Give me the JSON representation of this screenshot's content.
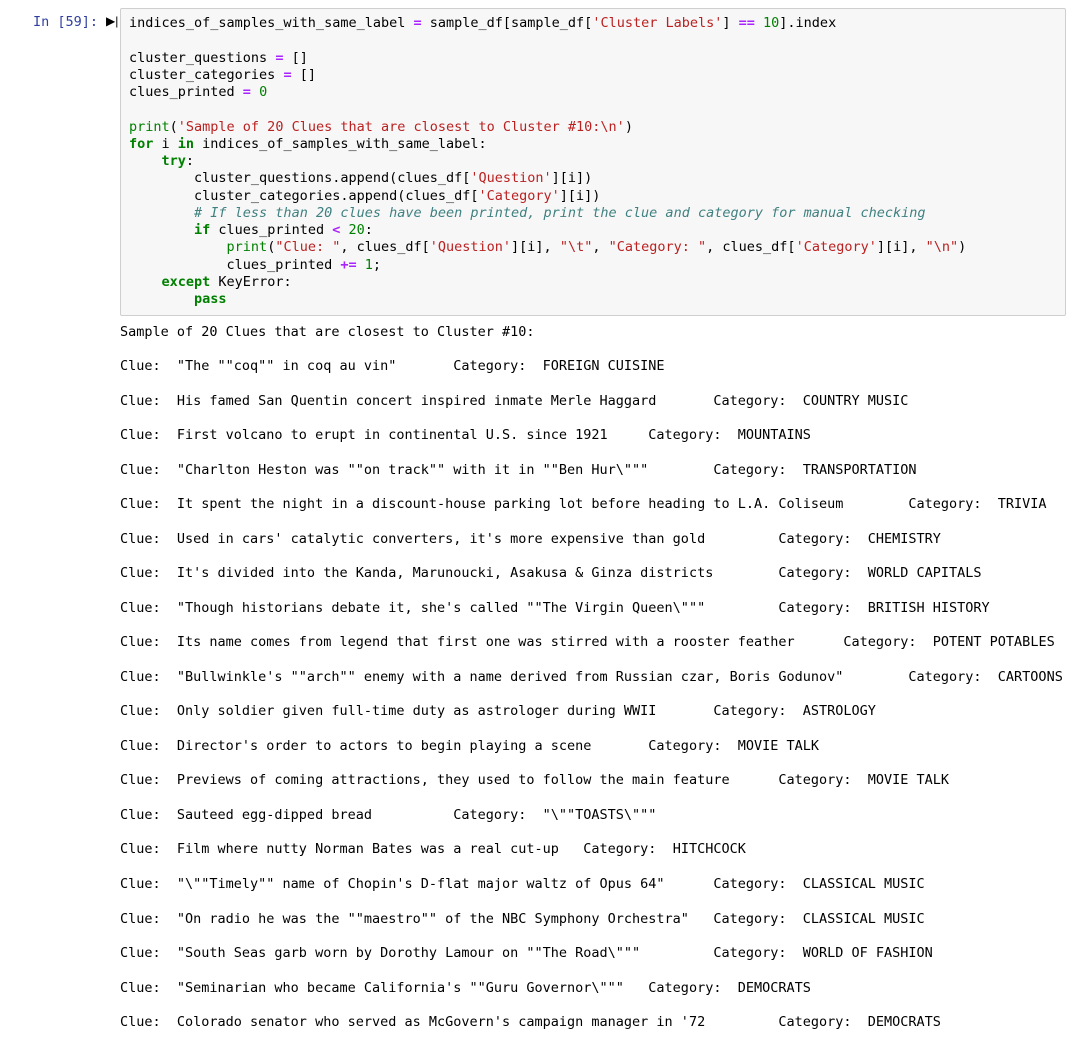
{
  "cell": {
    "prompt": "In [59]:",
    "code_lines": [
      [
        [
          "",
          "indices_of_samples_with_same_label "
        ],
        [
          "op",
          "="
        ],
        [
          "",
          " sample_df[sample_df["
        ],
        [
          "str",
          "'Cluster Labels'"
        ],
        [
          "",
          "] "
        ],
        [
          "op",
          "=="
        ],
        [
          "",
          " "
        ],
        [
          "num",
          "10"
        ],
        [
          "",
          "].index"
        ]
      ],
      [
        [
          "",
          ""
        ]
      ],
      [
        [
          "",
          "cluster_questions "
        ],
        [
          "op",
          "="
        ],
        [
          "",
          " []"
        ]
      ],
      [
        [
          "",
          "cluster_categories "
        ],
        [
          "op",
          "="
        ],
        [
          "",
          " []"
        ]
      ],
      [
        [
          "",
          "clues_printed "
        ],
        [
          "op",
          "="
        ],
        [
          "",
          " "
        ],
        [
          "num",
          "0"
        ]
      ],
      [
        [
          "",
          ""
        ]
      ],
      [
        [
          "bi",
          "print"
        ],
        [
          "",
          "("
        ],
        [
          "str",
          "'Sample of 20 Clues that are closest to Cluster #10:\\n'"
        ],
        [
          "",
          ")"
        ]
      ],
      [
        [
          "kw",
          "for"
        ],
        [
          "",
          " i "
        ],
        [
          "kw",
          "in"
        ],
        [
          "",
          " indices_of_samples_with_same_label:"
        ]
      ],
      [
        [
          "",
          "    "
        ],
        [
          "kw",
          "try"
        ],
        [
          "",
          ":"
        ]
      ],
      [
        [
          "",
          "        cluster_questions.append(clues_df["
        ],
        [
          "str",
          "'Question'"
        ],
        [
          "",
          "][i])"
        ]
      ],
      [
        [
          "",
          "        cluster_categories.append(clues_df["
        ],
        [
          "str",
          "'Category'"
        ],
        [
          "",
          "][i])"
        ]
      ],
      [
        [
          "",
          "        "
        ],
        [
          "cm",
          "# If less than 20 clues have been printed, print the clue and category for manual checking"
        ]
      ],
      [
        [
          "",
          "        "
        ],
        [
          "kw",
          "if"
        ],
        [
          "",
          " clues_printed "
        ],
        [
          "op",
          "<"
        ],
        [
          "",
          " "
        ],
        [
          "num",
          "20"
        ],
        [
          "",
          ":"
        ]
      ],
      [
        [
          "",
          "            "
        ],
        [
          "bi",
          "print"
        ],
        [
          "",
          "("
        ],
        [
          "str",
          "\"Clue: \""
        ],
        [
          "",
          ", clues_df["
        ],
        [
          "str",
          "'Question'"
        ],
        [
          "",
          "][i], "
        ],
        [
          "str",
          "\"\\t\""
        ],
        [
          "",
          ", "
        ],
        [
          "str",
          "\"Category: \""
        ],
        [
          "",
          ", clues_df["
        ],
        [
          "str",
          "'Category'"
        ],
        [
          "",
          "][i], "
        ],
        [
          "str",
          "\"\\n\""
        ],
        [
          "",
          ")"
        ]
      ],
      [
        [
          "",
          "            clues_printed "
        ],
        [
          "op",
          "+="
        ],
        [
          "",
          " "
        ],
        [
          "num",
          "1"
        ],
        [
          "",
          ";"
        ]
      ],
      [
        [
          "",
          "    "
        ],
        [
          "kw",
          "except"
        ],
        [
          "",
          " KeyError:"
        ]
      ],
      [
        [
          "",
          "        "
        ],
        [
          "kw",
          "pass"
        ]
      ]
    ]
  },
  "output": {
    "header": "Sample of 20 Clues that are closest to Cluster #10:",
    "rows": [
      {
        "clue": "\"The \"\"coq\"\" in coq au vin\"",
        "cat": "FOREIGN CUISINE"
      },
      {
        "clue": "His famed San Quentin concert inspired inmate Merle Haggard",
        "cat": "COUNTRY MUSIC"
      },
      {
        "clue": "First volcano to erupt in continental U.S. since 1921",
        "cat": "MOUNTAINS"
      },
      {
        "clue": "\"Charlton Heston was \"\"on track\"\" with it in \"\"Ben Hur\\\"\"\"",
        "cat": "TRANSPORTATION"
      },
      {
        "clue": "It spent the night in a discount-house parking lot before heading to L.A. Coliseum",
        "cat": "TRIVIA"
      },
      {
        "clue": "Used in cars' catalytic converters, it's more expensive than gold",
        "cat": "CHEMISTRY"
      },
      {
        "clue": "It's divided into the Kanda, Marunoucki, Asakusa & Ginza districts",
        "cat": "WORLD CAPITALS"
      },
      {
        "clue": "\"Though historians debate it, she's called \"\"The Virgin Queen\\\"\"\"",
        "cat": "BRITISH HISTORY"
      },
      {
        "clue": "Its name comes from legend that first one was stirred with a rooster feather",
        "cat": "POTENT POTABLES"
      },
      {
        "clue": "\"Bullwinkle's \"\"arch\"\" enemy with a name derived from Russian czar, Boris Godunov\"",
        "cat": "CARTOONS"
      },
      {
        "clue": "Only soldier given full-time duty as astrologer during WWII",
        "cat": "ASTROLOGY"
      },
      {
        "clue": "Director's order to actors to begin playing a scene",
        "cat": "MOVIE TALK"
      },
      {
        "clue": "Previews of coming attractions, they used to follow the main feature",
        "cat": "MOVIE TALK"
      },
      {
        "clue": "Sauteed egg-dipped bread",
        "cat": "\"\\\"\"TOASTS\\\"\"\""
      },
      {
        "clue": "Film where nutty Norman Bates was a real cut-up",
        "cat": "HITCHCOCK"
      },
      {
        "clue": "\"\\\"\"Timely\"\" name of Chopin's D-flat major waltz of Opus 64\"",
        "cat": "CLASSICAL MUSIC"
      },
      {
        "clue": "\"On radio he was the \"\"maestro\"\" of the NBC Symphony Orchestra\"",
        "cat": "CLASSICAL MUSIC"
      },
      {
        "clue": "\"South Seas garb worn by Dorothy Lamour on \"\"The Road\\\"\"\"",
        "cat": "WORLD OF FASHION"
      },
      {
        "clue": "\"Seminarian who became California's \"\"Guru Governor\\\"\"\"",
        "cat": "DEMOCRATS"
      },
      {
        "clue": "Colorado senator who served as McGovern's campaign manager in '72",
        "cat": "DEMOCRATS"
      }
    ]
  }
}
